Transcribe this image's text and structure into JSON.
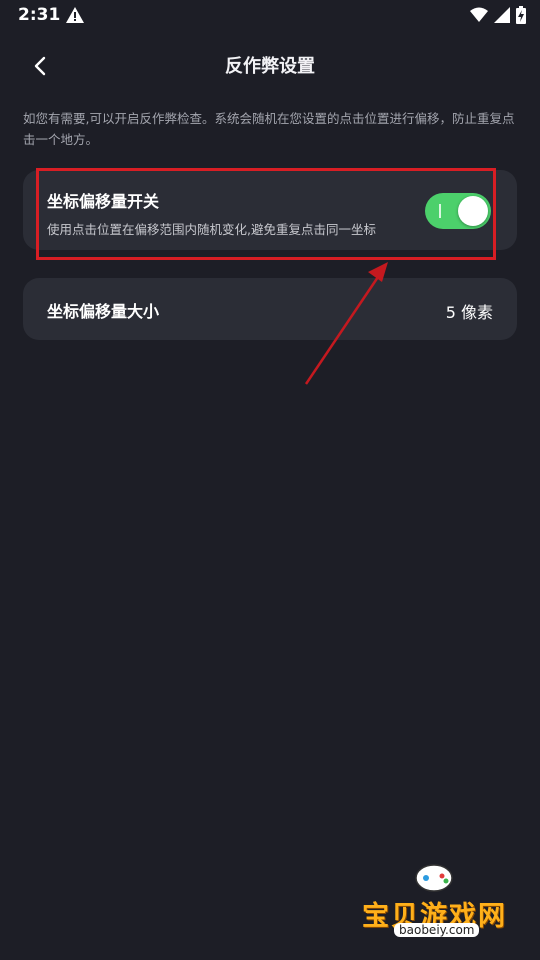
{
  "status_bar": {
    "time": "2:31"
  },
  "header": {
    "title": "反作弊设置"
  },
  "description": "如您有需要,可以开启反作弊检查。系统会随机在您设置的点击位置进行偏移，防止重复点击一个地方。",
  "settings": [
    {
      "title": "坐标偏移量开关",
      "subtitle": "使用点击位置在偏移范围内随机变化,避免重复点击同一坐标",
      "toggle_on": true
    },
    {
      "title": "坐标偏移量大小",
      "value": "5 像素"
    }
  ],
  "colors": {
    "background": "#1d1e26",
    "card": "#2b2d36",
    "toggle_on": "#4cd06b",
    "highlight": "#d81e24"
  },
  "watermark": {
    "brand": "宝贝游戏网",
    "url": "baobeiy.com"
  }
}
